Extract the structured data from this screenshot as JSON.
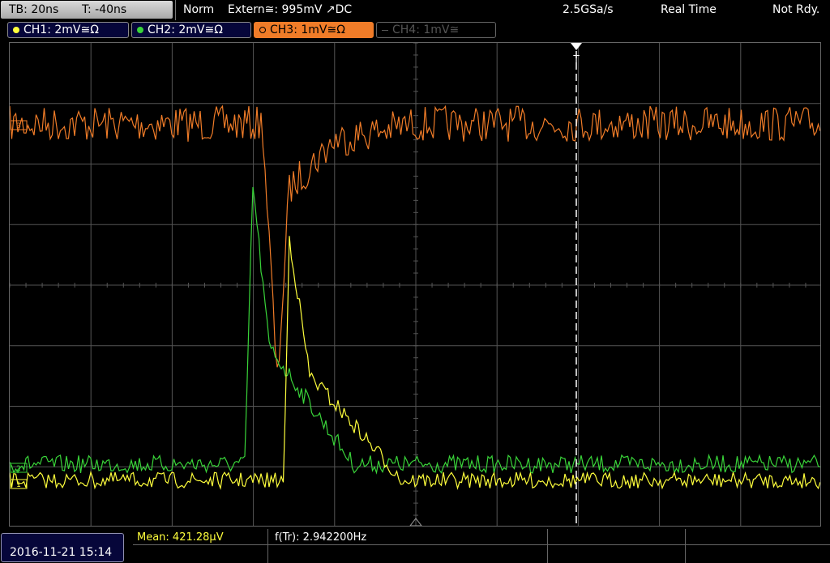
{
  "status": {
    "timebase": "TB: 20ns",
    "trigger_time": "T: -40ns",
    "trigger_mode": "Norm",
    "trigger_source": "Extern≅: 995mV ↗DC",
    "sample_rate": "2.5GSa/s",
    "acq_mode": "Real Time",
    "state": "Not Rdy."
  },
  "channels": [
    {
      "label": "CH1: 2mV≅Ω",
      "color": "#ffff3c",
      "state": "on"
    },
    {
      "label": "CH2: 2mV≅Ω",
      "color": "#39d439",
      "state": "on"
    },
    {
      "label": "CH3: 1mV≅Ω",
      "color": "#f07c28",
      "state": "active"
    },
    {
      "label": "CH4: 1mV≅",
      "color": "#666666",
      "state": "off"
    }
  ],
  "markers": {
    "trigger": "T",
    "ch3_ref": "3",
    "ch2_ref": "2",
    "ch1_ref": "1"
  },
  "bottom": {
    "datetime": "2016-11-21 15:14",
    "mean": "Mean: 421.28µV",
    "freq": "f(Tr): 2.942200Hz"
  },
  "colors": {
    "ch1": "#ffff3c",
    "ch2": "#39d439",
    "ch3": "#f07c28",
    "grid": "#555555",
    "screen_bg": "#000000"
  }
}
